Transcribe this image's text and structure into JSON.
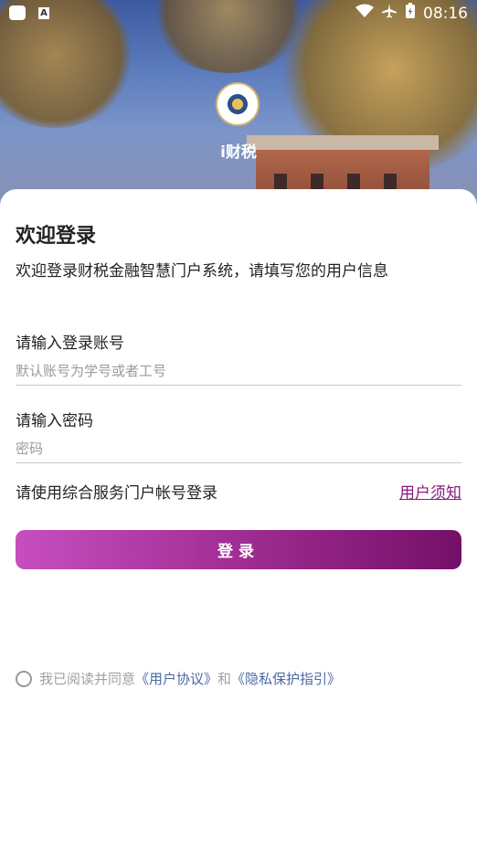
{
  "status_bar": {
    "time": "08:16",
    "notif_letter": "A"
  },
  "app": {
    "name": "i财税"
  },
  "login": {
    "title": "欢迎登录",
    "subtitle": "欢迎登录财税金融智慧门户系统，请填写您的用户信息",
    "account_label": "请输入登录账号",
    "account_placeholder": "默认账号为学号或者工号",
    "password_label": "请输入密码",
    "password_placeholder": "密码",
    "hint": "请使用综合服务门户帐号登录",
    "notice_link": "用户须知",
    "submit_label": "登录"
  },
  "agreement": {
    "prefix": "我已阅读并同意",
    "user_agreement": "《用户协议》",
    "and": "和",
    "privacy": "《隐私保护指引》"
  },
  "colors": {
    "accent": "#8b1a7f",
    "button_start": "#c74ec0",
    "button_end": "#741069",
    "link": "#4a6aa3"
  }
}
